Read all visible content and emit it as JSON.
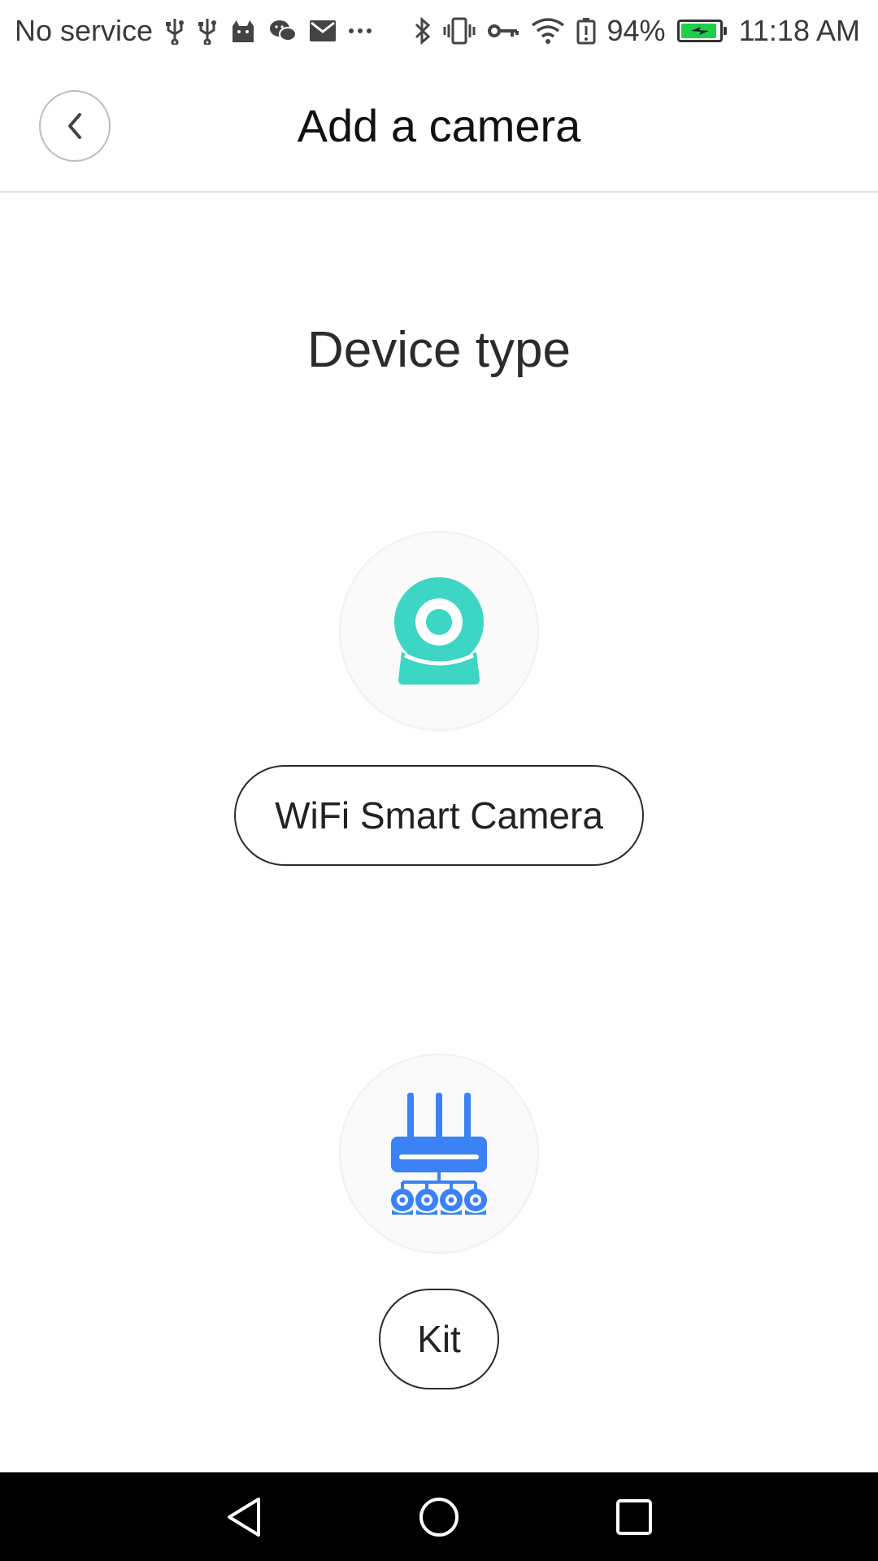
{
  "status_bar": {
    "carrier": "No service",
    "battery_percent": "94%",
    "battery_level": 0.94,
    "time": "11:18 AM",
    "left_icons": [
      "usb-icon",
      "usb-icon",
      "cat-app-icon",
      "wechat-icon",
      "mail-icon",
      "more-icon"
    ],
    "right_icons": [
      "bluetooth-icon",
      "vibrate-icon",
      "vpn-key-icon",
      "wifi-icon",
      "battery-alert-icon",
      "battery-charging-icon"
    ]
  },
  "header": {
    "title": "Add a camera",
    "back_icon": "chevron-left-icon"
  },
  "main": {
    "section_title": "Device type",
    "devices": [
      {
        "label": "WiFi Smart Camera",
        "icon": "webcam-icon",
        "icon_color": "#3dd5c4"
      },
      {
        "label": "Kit",
        "icon": "nvr-kit-icon",
        "icon_color": "#3b82f6"
      }
    ]
  },
  "nav_bar": {
    "buttons": [
      "back-triangle-icon",
      "home-circle-icon",
      "recents-square-icon"
    ]
  },
  "colors": {
    "accent_teal": "#3dd5c4",
    "accent_blue": "#3b82f6",
    "battery_green": "#1fcf4a"
  }
}
